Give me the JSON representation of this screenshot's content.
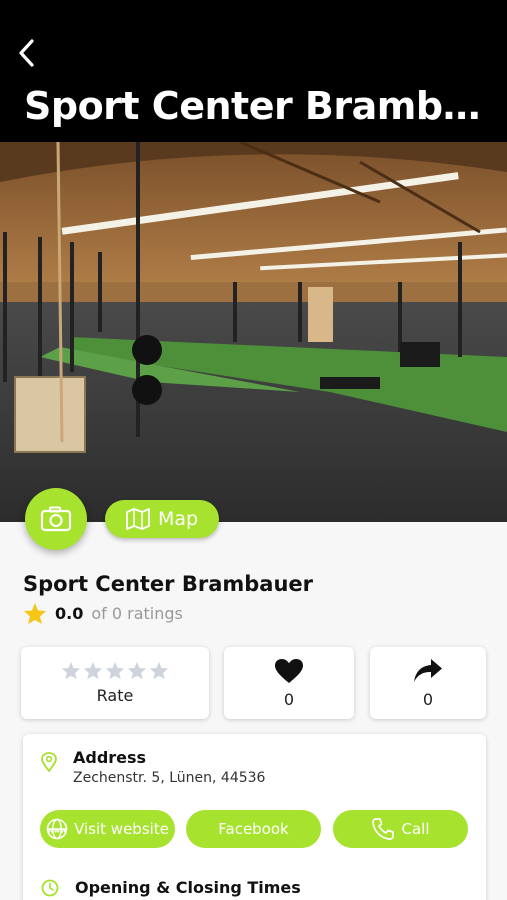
{
  "header": {
    "title": "Sport Center Bramba..."
  },
  "actions": {
    "map_label": "Map"
  },
  "venue": {
    "name": "Sport Center Brambauer",
    "rating_value": "0.0",
    "rating_suffix": "of 0 ratings"
  },
  "stats": {
    "rate_label": "Rate",
    "likes": "0",
    "shares": "0"
  },
  "info": {
    "address_title": "Address",
    "address_text": "Zechenstr. 5, Lünen, 44536",
    "website_label": "Visit website",
    "facebook_label": "Facebook",
    "call_label": "Call",
    "hours_title": "Opening & Closing Times"
  },
  "colors": {
    "accent": "#a6e22e",
    "header_bg": "#000000",
    "star_filled": "#f5c518",
    "star_empty": "#cfd3dc"
  }
}
